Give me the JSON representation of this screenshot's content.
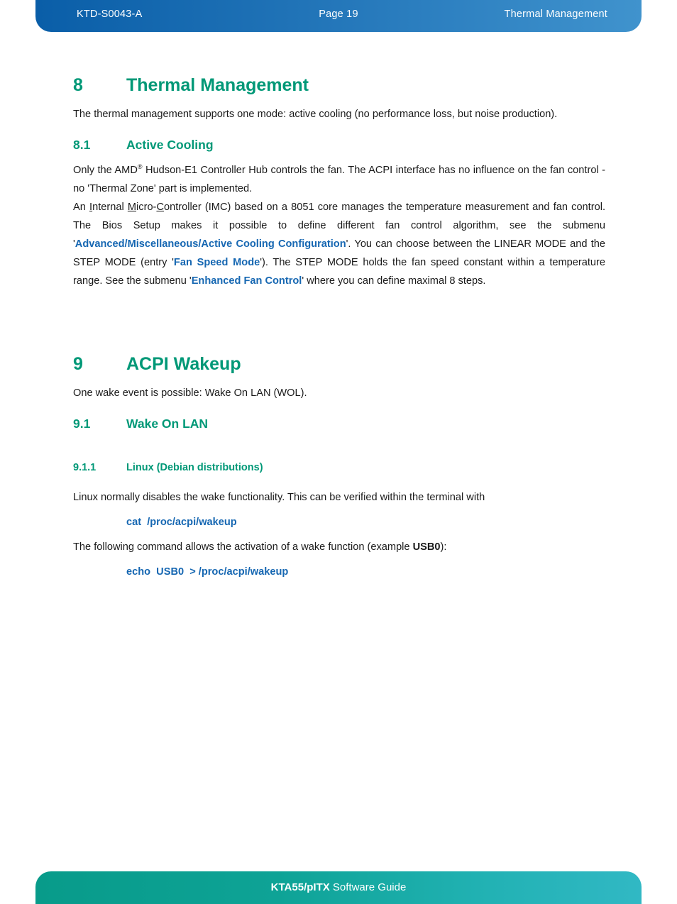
{
  "header": {
    "doc_id": "KTD-S0043-A",
    "page_label": "Page 19",
    "chapter": "Thermal Management"
  },
  "footer": {
    "product": "KTA55/pITX",
    "suffix": " Software Guide"
  },
  "sections": {
    "thermal": {
      "number": "8",
      "title": "Thermal Management",
      "intro": "The thermal management supports one mode: active cooling (no performance loss, but noise production).",
      "sub": {
        "number": "8.1",
        "title": "Active Cooling",
        "para1_a": "Only the AMD",
        "para1_reg": "®",
        "para1_b": " Hudson-E1 Controller Hub controls the fan. The ACPI interface has no influence on the fan control - no 'Thermal Zone' part is implemented.",
        "para2_a": "An ",
        "para2_u1": "I",
        "para2_b": "nternal ",
        "para2_u2": "M",
        "para2_c": "icro-",
        "para2_u3": "C",
        "para2_d": "ontroller (IMC) based on a 8051 core manages the temperature measurement and fan control. The Bios Setup makes it possible to define different fan control algorithm, see the submenu '",
        "link1": "Advanced/Miscellaneous/Active Cooling Configuration",
        "para2_e": "'. You can choose between the LINEAR MODE and the STEP MODE (entry '",
        "link2": "Fan Speed Mode",
        "para2_f": "'). The STEP MODE holds the fan speed constant within a temperature range. See the submenu '",
        "link3": "Enhanced Fan Control",
        "para2_g": "' where you can define maximal 8 steps."
      }
    },
    "acpi": {
      "number": "9",
      "title": "ACPI Wakeup",
      "intro": "One wake event is possible: Wake On LAN (WOL).",
      "sub": {
        "number": "9.1",
        "title": "Wake On LAN",
        "subsub": {
          "number": "9.1.1",
          "title": "Linux (Debian distributions)",
          "para1": "Linux normally disables the wake functionality. This can be verified within the terminal with",
          "command1": "cat  /proc/acpi/wakeup",
          "para2_a": "The following command allows the activation of a wake function (example ",
          "para2_bold": "USB0",
          "para2_b": "):",
          "command2": "echo  USB0  > /proc/acpi/wakeup"
        }
      }
    }
  },
  "colors": {
    "heading_teal": "#009877",
    "link_blue": "#1667b2",
    "header_blue_dark": "#0a5ea8",
    "header_blue_light": "#4093cd",
    "footer_teal_dark": "#089b8a",
    "footer_teal_light": "#31b8c4"
  }
}
